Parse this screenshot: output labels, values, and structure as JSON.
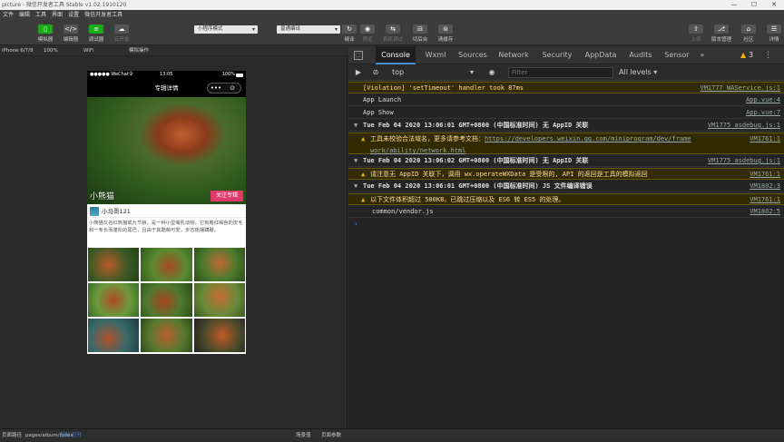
{
  "window": {
    "title": "picture - 微信开发者工具 Stable v1.02.1910120",
    "controls": [
      "—",
      "☐",
      "✕"
    ]
  },
  "menu": [
    "文件",
    "编辑",
    "工具",
    "界面",
    "设置",
    "微信开发者工具"
  ],
  "toolbar": {
    "left_buttons": [
      {
        "label": "模拟器",
        "icon": "phone-icon"
      },
      {
        "label": "编辑器",
        "icon": "code-icon"
      },
      {
        "label": "调试器",
        "icon": "debug-icon"
      },
      {
        "label": "云开发",
        "icon": "cloud-icon"
      }
    ],
    "mode_select": "小程序模式",
    "compile_select": "普通编译",
    "mid_buttons": [
      {
        "label": "编译",
        "icon": "refresh-icon"
      },
      {
        "label": "预览",
        "icon": "eye-icon"
      },
      {
        "label": "真机调试",
        "icon": "realdevice-icon"
      },
      {
        "label": "切后台",
        "icon": "background-icon"
      },
      {
        "label": "清缓存",
        "icon": "clear-cache-icon"
      }
    ],
    "right_buttons": [
      {
        "label": "上传",
        "icon": "upload-icon"
      },
      {
        "label": "版本管理",
        "icon": "version-icon"
      },
      {
        "label": "社区",
        "icon": "community-icon"
      },
      {
        "label": "详情",
        "icon": "details-icon"
      }
    ]
  },
  "simulator_bar": {
    "device": "iPhone 6/7/8",
    "zoom": "100%",
    "network": "WiFi",
    "action": "模拟操作"
  },
  "phone": {
    "status": {
      "carrier": "●●●●● WeChat令",
      "time": "13:05",
      "battery": "100%"
    },
    "nav_title": "专辑详情",
    "capsule": [
      "•••",
      "⊙"
    ],
    "banner_title": "小熊猫",
    "follow_label": "关注专辑",
    "author": "小马哥121",
    "description": "小熊猫又名红熊猫或九节狼，是一种小型哺乳动物，它有着红褐色的皮毛和一条长而蓬松的尾巴，且由于其酷萌可爱，步态摇摆蹒跚。",
    "photo_count": 9
  },
  "bottom_bar": {
    "path_label": "页面路径",
    "path": "pages/album/index",
    "copy": "复制",
    "open": "打开",
    "scene": "场景值",
    "params": "页面参数"
  },
  "devtools": {
    "tabs": [
      "Console",
      "Wxml",
      "Sources",
      "Network",
      "Security",
      "AppData",
      "Audits",
      "Sensor",
      "»"
    ],
    "warn_count": "3",
    "context": "top",
    "filter_placeholder": "Filter",
    "levels": "All levels ▾"
  },
  "console": [
    {
      "kind": "warn-plain",
      "text": "[Violation] 'setTimeout' handler took 87ms",
      "src": "VM1777 WAService.js:1"
    },
    {
      "kind": "log",
      "text": "App Launch",
      "src": "App.vue:4"
    },
    {
      "kind": "log",
      "text": "App Show",
      "src": "App.vue:7"
    },
    {
      "kind": "group",
      "text": "Tue Feb 04 2020 13:06:01 GMT+0800 (中国标准时间) 无 AppID 关联",
      "src": "VM1775 asdebug.js:1"
    },
    {
      "kind": "warn",
      "text": "工具未校验合法域名，更多请参考文档：",
      "link": "https://developers.weixin.qq.com/miniprogram/dev/frame",
      "link2": "work/ability/network.html",
      "src": "VM1761:1"
    },
    {
      "kind": "group",
      "text": "Tue Feb 04 2020 13:06:02 GMT+0800 (中国标准时间) 无 AppID 关联",
      "src": "VM1775 asdebug.js:1"
    },
    {
      "kind": "warn",
      "text": "请注意无 AppID 关联下，调用 wx.operateWXData 是受限的, API 的返回是工具的模拟返回",
      "src": "VM1761:1"
    },
    {
      "kind": "group",
      "text": "Tue Feb 04 2020 13:06:01 GMT+0800 (中国标准时间) JS 文件编译错误",
      "src": "VM1802:3"
    },
    {
      "kind": "warn",
      "text": "以下文件体积超过 500KB，已跳过压缩以及 ES6 转 ES5 的处理。",
      "src": "VM1761:1"
    },
    {
      "kind": "log2",
      "text": "common/vendor.js",
      "src": "VM1802:5"
    }
  ],
  "colors": {
    "accent": "#1aad19",
    "follow": "#e0396b",
    "warn_bg": "#332b00",
    "tab_active": "#4a8bd6"
  }
}
